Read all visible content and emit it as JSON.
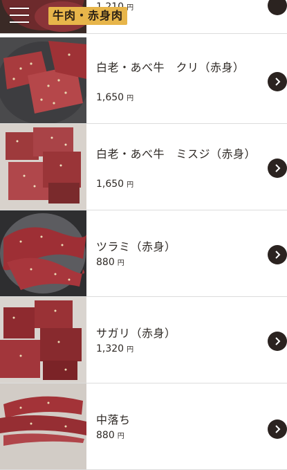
{
  "header": {
    "category_label": "牛肉・赤身肉",
    "menu_icon": "hamburger-icon"
  },
  "top_item": {
    "price": "1,210",
    "yen": "円"
  },
  "items": [
    {
      "name": "白老・あべ牛　クリ（赤身）",
      "price": "1,650",
      "yen": "円"
    },
    {
      "name": "白老・あべ牛　ミスジ（赤身）",
      "price": "1,650",
      "yen": "円"
    },
    {
      "name": "ツラミ（赤身）",
      "price": "880",
      "yen": "円"
    },
    {
      "name": "サガリ（赤身）",
      "price": "1,320",
      "yen": "円"
    },
    {
      "name": "中落ち",
      "price": "880",
      "yen": "円"
    }
  ],
  "colors": {
    "accent": "#e7b54a",
    "arrow_button": "#2b2320"
  },
  "arrow_icon": "chevron-right-icon"
}
